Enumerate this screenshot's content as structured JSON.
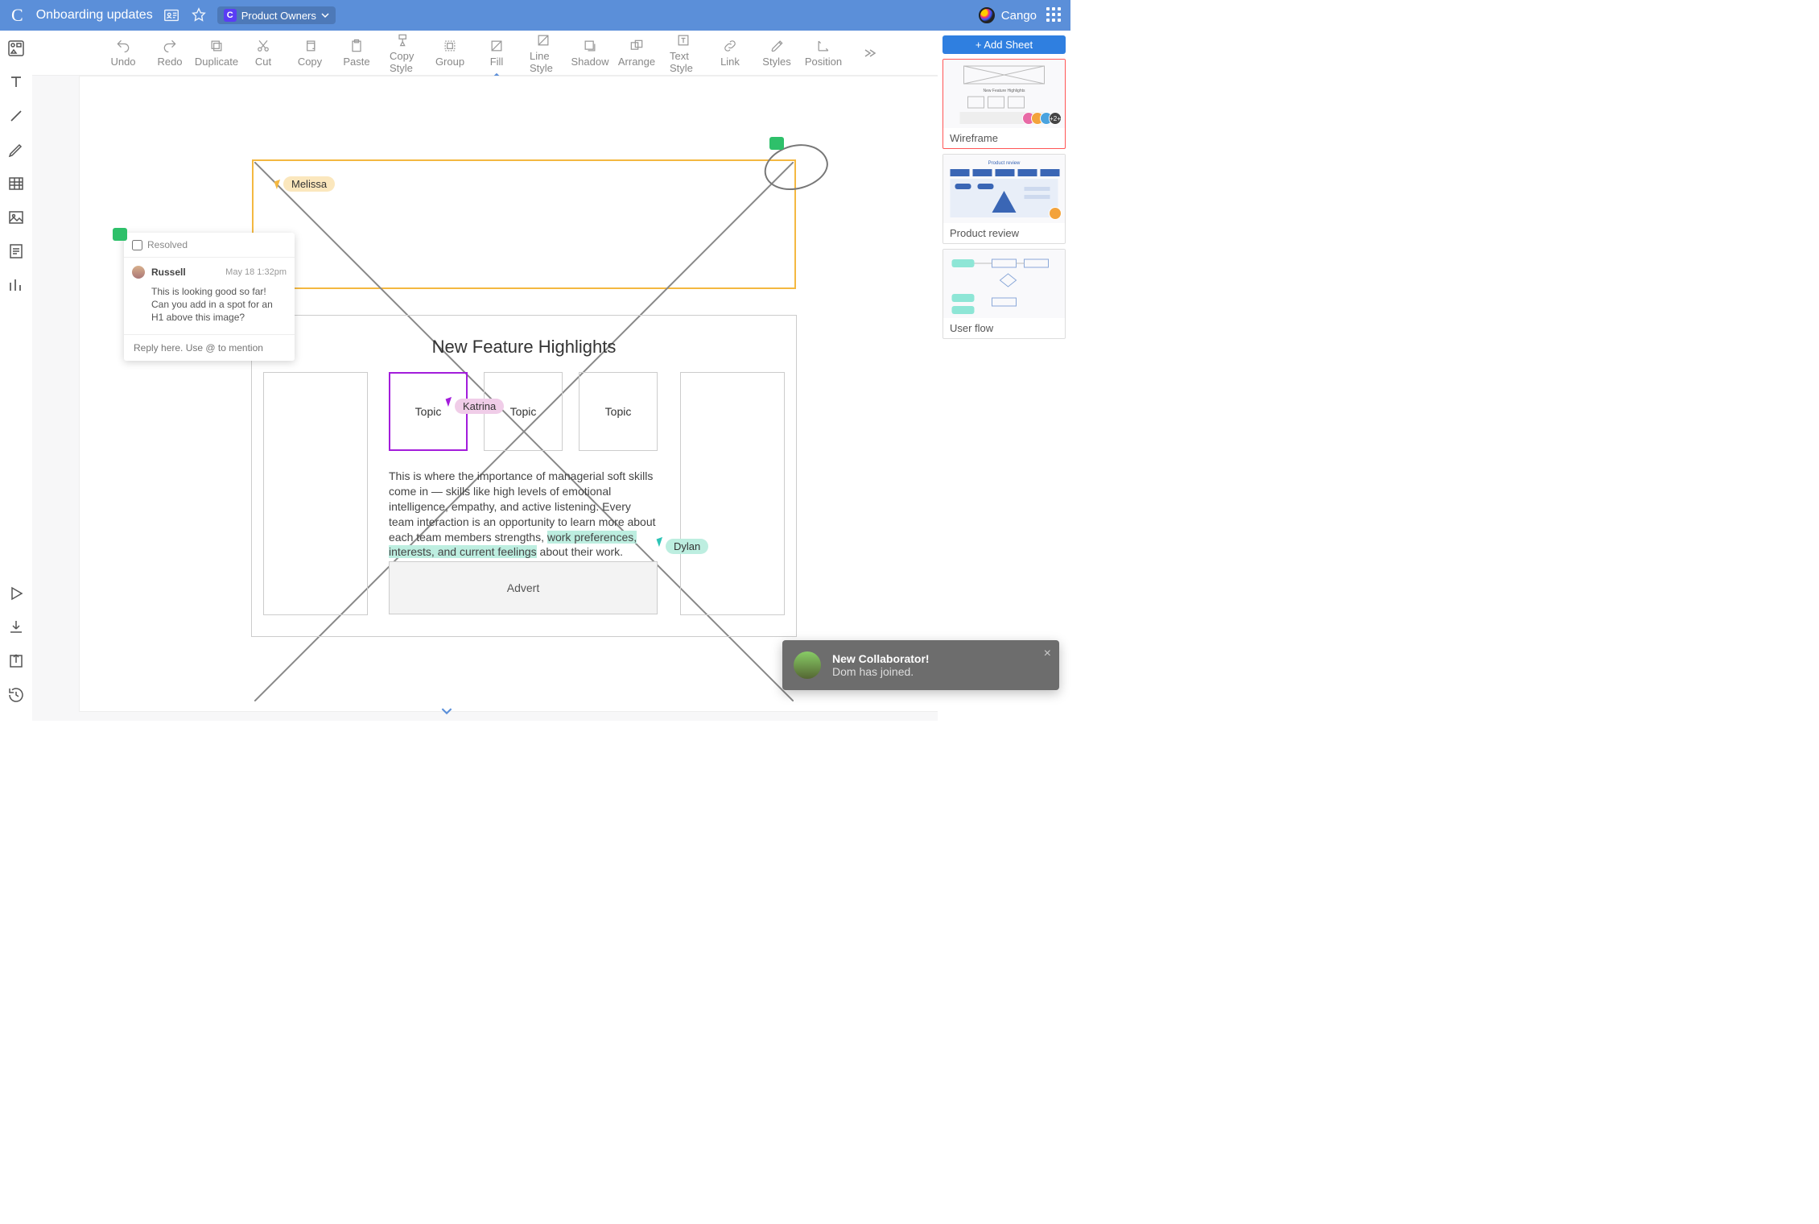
{
  "header": {
    "doc_title": "Onboarding updates",
    "share_label": "Product Owners",
    "brand": "Cango"
  },
  "ribbon": {
    "items": [
      {
        "id": "undo",
        "label": "Undo"
      },
      {
        "id": "redo",
        "label": "Redo"
      },
      {
        "id": "duplicate",
        "label": "Duplicate"
      },
      {
        "id": "cut",
        "label": "Cut"
      },
      {
        "id": "copy",
        "label": "Copy"
      },
      {
        "id": "paste",
        "label": "Paste"
      },
      {
        "id": "copy-style",
        "label": "Copy Style"
      },
      {
        "id": "group",
        "label": "Group"
      },
      {
        "id": "fill",
        "label": "Fill"
      },
      {
        "id": "line-style",
        "label": "Line Style"
      },
      {
        "id": "shadow",
        "label": "Shadow"
      },
      {
        "id": "arrange",
        "label": "Arrange"
      },
      {
        "id": "text-style",
        "label": "Text Style"
      },
      {
        "id": "link",
        "label": "Link"
      },
      {
        "id": "styles",
        "label": "Styles"
      },
      {
        "id": "position",
        "label": "Position"
      }
    ]
  },
  "cursors": {
    "melissa": "Melissa",
    "katrina": "Katrina",
    "dylan": "Dylan"
  },
  "section_title": "New Feature Highlights",
  "topics": [
    "Topic",
    "Topic",
    "Topic"
  ],
  "advert": "Advert",
  "body_text_pre": "This is where the importance of managerial soft skills come in — skills like high levels of emotional intelligence, empathy, and active listening. Every team interaction is an opportunity to learn more about each team members strengths, ",
  "body_text_hl": "work preferences, interests, and current feelings",
  "body_text_post": " about their work.",
  "comment": {
    "resolved_label": "Resolved",
    "user": "Russell",
    "timestamp": "May 18 1:32pm",
    "message": "This is looking good so far! Can you add in a spot for an H1 above this image?",
    "reply_placeholder": "Reply here. Use @ to mention"
  },
  "right_panel": {
    "add_sheet": "+ Add Sheet",
    "sheets": [
      {
        "title": "Wireframe",
        "active": true,
        "overflow": "+2+"
      },
      {
        "title": "Product review",
        "active": false
      },
      {
        "title": "User flow",
        "active": false
      }
    ]
  },
  "toast": {
    "title": "New Collaborator!",
    "body": "Dom has joined."
  }
}
